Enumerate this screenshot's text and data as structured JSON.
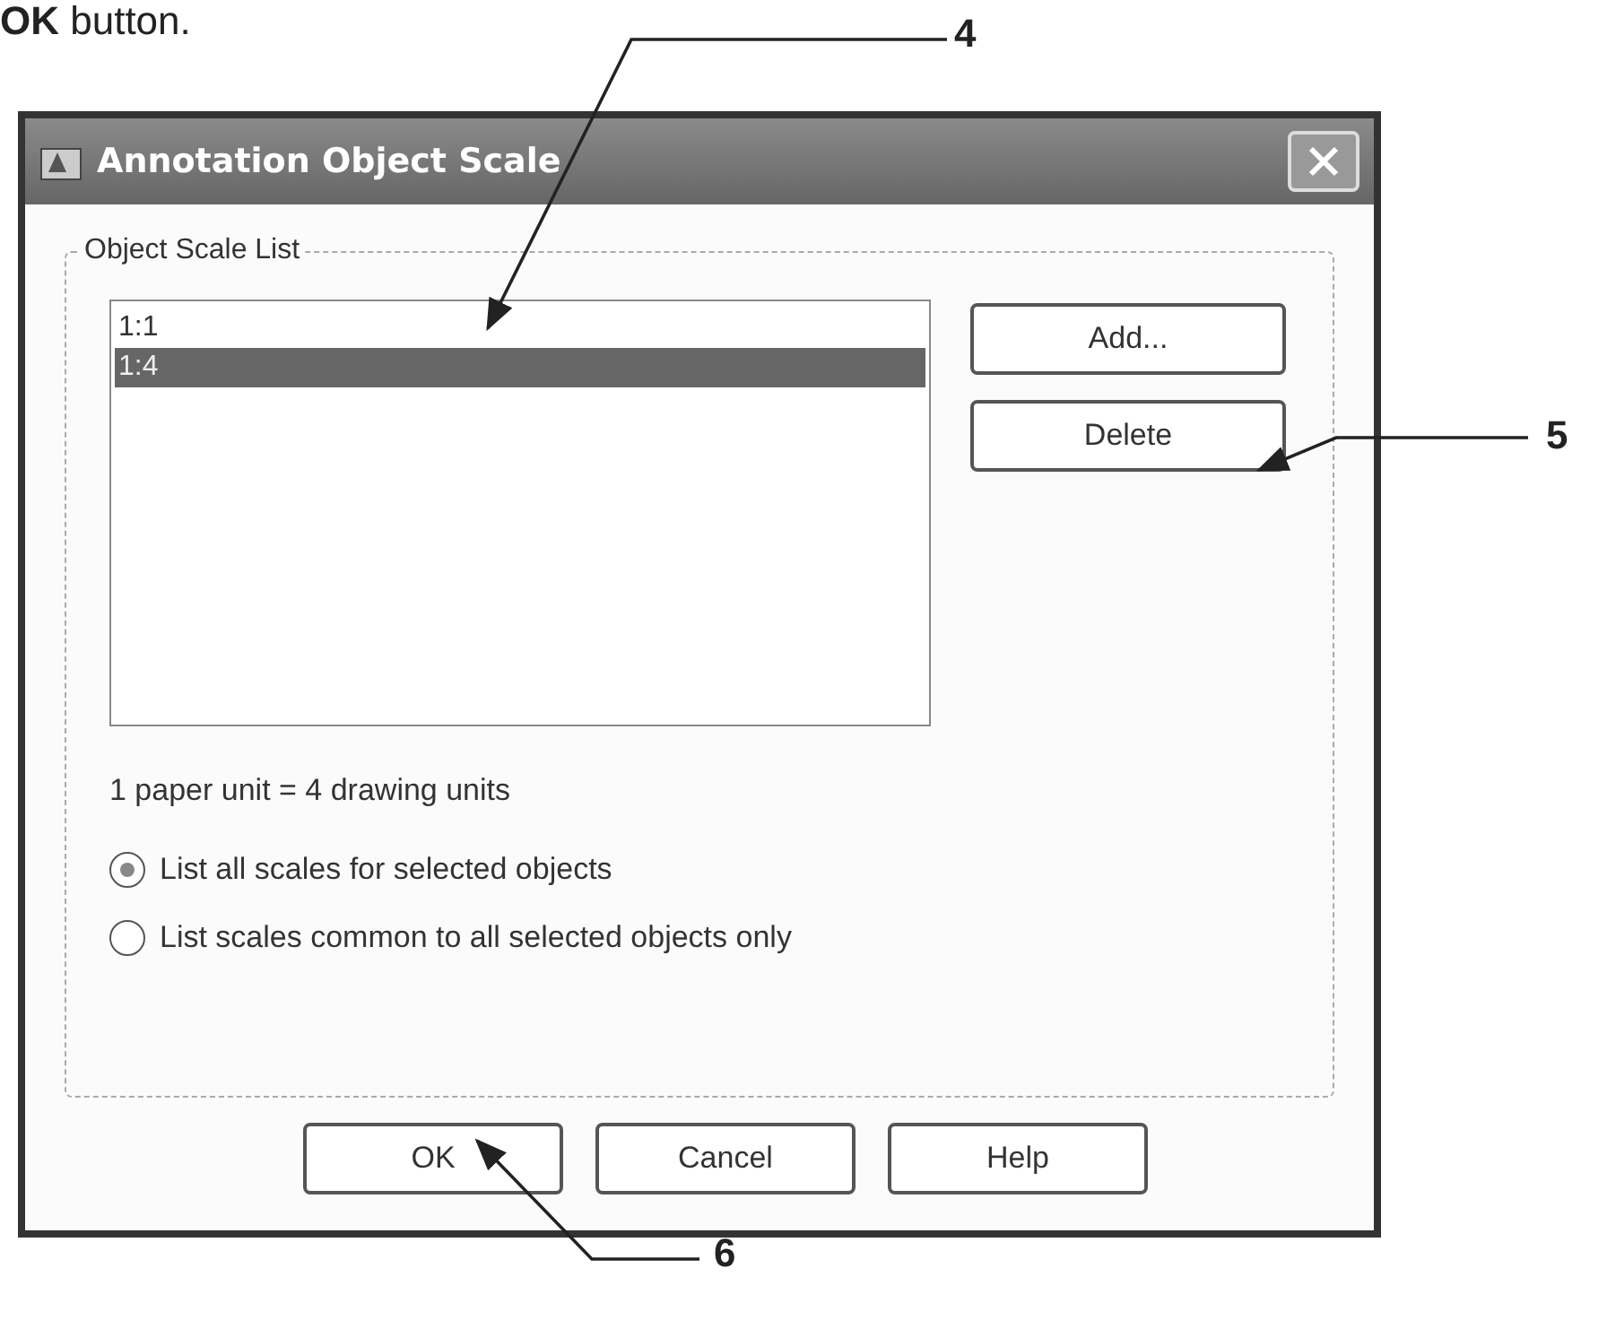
{
  "caption": "**OK** button.",
  "callouts": [
    {
      "label": "4"
    },
    {
      "label": "5"
    },
    {
      "label": "6"
    }
  ],
  "dialog": {
    "title": "Annotation Object Scale",
    "group_label": "Object Scale List",
    "scales": [
      {
        "label": "1:1",
        "selected": false
      },
      {
        "label": "1:4",
        "selected": true
      }
    ],
    "side_buttons": [
      "Add...",
      "Delete"
    ],
    "ratio_text": "1 paper unit = 4 drawing units",
    "options": [
      {
        "label": "List all scales for selected objects",
        "selected": true
      },
      {
        "label": "List scales common to all selected objects only",
        "selected": false
      }
    ],
    "buttons": [
      "OK",
      "Cancel",
      "Help"
    ]
  }
}
